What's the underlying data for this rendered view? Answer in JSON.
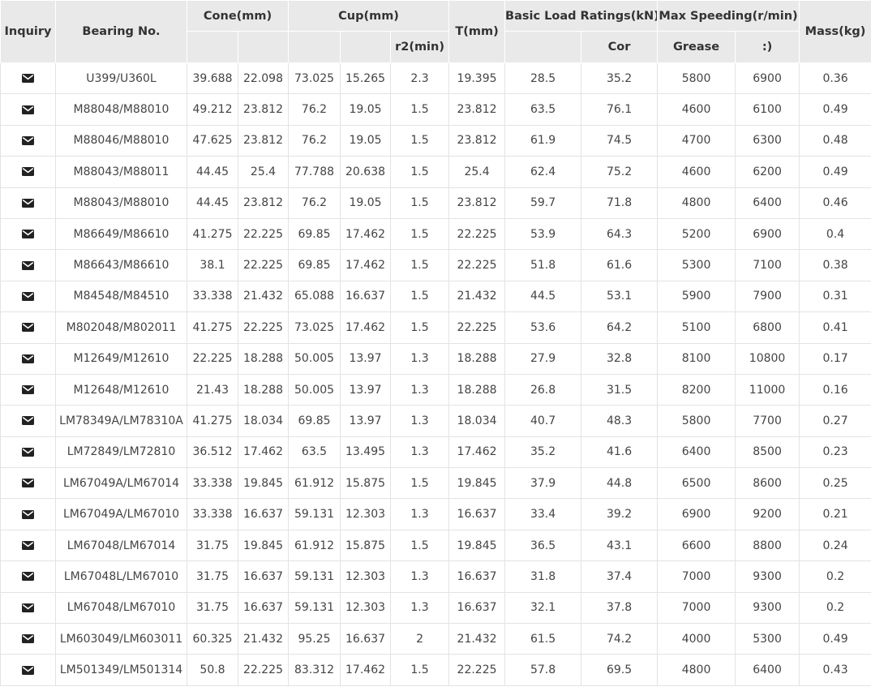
{
  "columns": {
    "inquiry": "Inquiry",
    "bearing_no": "Bearing No.",
    "cone": "Cone(mm)",
    "cup": "Cup(mm)",
    "r2_min": "r2(min)",
    "t": "T(mm)",
    "basic_load": "Basic Load Ratings(kN)",
    "cor": "Cor",
    "max_speed": "Max Speeding(r/min)",
    "grease": "Grease",
    "oil": ":)",
    "mass": "Mass(kg)"
  },
  "icons": {
    "inquiry": "envelope-icon"
  },
  "rows": [
    {
      "bearing": "U399/U360L",
      "cone1": "39.688",
      "cone2": "22.098",
      "cup1": "73.025",
      "cup2": "15.265",
      "r2": "2.3",
      "t": "19.395",
      "cr": "28.5",
      "cor": "35.2",
      "grease": "5800",
      "oil": "6900",
      "mass": "0.36"
    },
    {
      "bearing": "M88048/M88010",
      "cone1": "49.212",
      "cone2": "23.812",
      "cup1": "76.2",
      "cup2": "19.05",
      "r2": "1.5",
      "t": "23.812",
      "cr": "63.5",
      "cor": "76.1",
      "grease": "4600",
      "oil": "6100",
      "mass": "0.49"
    },
    {
      "bearing": "M88046/M88010",
      "cone1": "47.625",
      "cone2": "23.812",
      "cup1": "76.2",
      "cup2": "19.05",
      "r2": "1.5",
      "t": "23.812",
      "cr": "61.9",
      "cor": "74.5",
      "grease": "4700",
      "oil": "6300",
      "mass": "0.48"
    },
    {
      "bearing": "M88043/M88011",
      "cone1": "44.45",
      "cone2": "25.4",
      "cup1": "77.788",
      "cup2": "20.638",
      "r2": "1.5",
      "t": "25.4",
      "cr": "62.4",
      "cor": "75.2",
      "grease": "4600",
      "oil": "6200",
      "mass": "0.49"
    },
    {
      "bearing": "M88043/M88010",
      "cone1": "44.45",
      "cone2": "23.812",
      "cup1": "76.2",
      "cup2": "19.05",
      "r2": "1.5",
      "t": "23.812",
      "cr": "59.7",
      "cor": "71.8",
      "grease": "4800",
      "oil": "6400",
      "mass": "0.46"
    },
    {
      "bearing": "M86649/M86610",
      "cone1": "41.275",
      "cone2": "22.225",
      "cup1": "69.85",
      "cup2": "17.462",
      "r2": "1.5",
      "t": "22.225",
      "cr": "53.9",
      "cor": "64.3",
      "grease": "5200",
      "oil": "6900",
      "mass": "0.4"
    },
    {
      "bearing": "M86643/M86610",
      "cone1": "38.1",
      "cone2": "22.225",
      "cup1": "69.85",
      "cup2": "17.462",
      "r2": "1.5",
      "t": "22.225",
      "cr": "51.8",
      "cor": "61.6",
      "grease": "5300",
      "oil": "7100",
      "mass": "0.38"
    },
    {
      "bearing": "M84548/M84510",
      "cone1": "33.338",
      "cone2": "21.432",
      "cup1": "65.088",
      "cup2": "16.637",
      "r2": "1.5",
      "t": "21.432",
      "cr": "44.5",
      "cor": "53.1",
      "grease": "5900",
      "oil": "7900",
      "mass": "0.31"
    },
    {
      "bearing": "M802048/M802011",
      "cone1": "41.275",
      "cone2": "22.225",
      "cup1": "73.025",
      "cup2": "17.462",
      "r2": "1.5",
      "t": "22.225",
      "cr": "53.6",
      "cor": "64.2",
      "grease": "5100",
      "oil": "6800",
      "mass": "0.41"
    },
    {
      "bearing": "M12649/M12610",
      "cone1": "22.225",
      "cone2": "18.288",
      "cup1": "50.005",
      "cup2": "13.97",
      "r2": "1.3",
      "t": "18.288",
      "cr": "27.9",
      "cor": "32.8",
      "grease": "8100",
      "oil": "10800",
      "mass": "0.17"
    },
    {
      "bearing": "M12648/M12610",
      "cone1": "21.43",
      "cone2": "18.288",
      "cup1": "50.005",
      "cup2": "13.97",
      "r2": "1.3",
      "t": "18.288",
      "cr": "26.8",
      "cor": "31.5",
      "grease": "8200",
      "oil": "11000",
      "mass": "0.16"
    },
    {
      "bearing": "LM78349A/LM78310A",
      "cone1": "41.275",
      "cone2": "18.034",
      "cup1": "69.85",
      "cup2": "13.97",
      "r2": "1.3",
      "t": "18.034",
      "cr": "40.7",
      "cor": "48.3",
      "grease": "5800",
      "oil": "7700",
      "mass": "0.27"
    },
    {
      "bearing": "LM72849/LM72810",
      "cone1": "36.512",
      "cone2": "17.462",
      "cup1": "63.5",
      "cup2": "13.495",
      "r2": "1.3",
      "t": "17.462",
      "cr": "35.2",
      "cor": "41.6",
      "grease": "6400",
      "oil": "8500",
      "mass": "0.23"
    },
    {
      "bearing": "LM67049A/LM67014",
      "cone1": "33.338",
      "cone2": "19.845",
      "cup1": "61.912",
      "cup2": "15.875",
      "r2": "1.5",
      "t": "19.845",
      "cr": "37.9",
      "cor": "44.8",
      "grease": "6500",
      "oil": "8600",
      "mass": "0.25"
    },
    {
      "bearing": "LM67049A/LM67010",
      "cone1": "33.338",
      "cone2": "16.637",
      "cup1": "59.131",
      "cup2": "12.303",
      "r2": "1.3",
      "t": "16.637",
      "cr": "33.4",
      "cor": "39.2",
      "grease": "6900",
      "oil": "9200",
      "mass": "0.21"
    },
    {
      "bearing": "LM67048/LM67014",
      "cone1": "31.75",
      "cone2": "19.845",
      "cup1": "61.912",
      "cup2": "15.875",
      "r2": "1.5",
      "t": "19.845",
      "cr": "36.5",
      "cor": "43.1",
      "grease": "6600",
      "oil": "8800",
      "mass": "0.24"
    },
    {
      "bearing": "LM67048L/LM67010",
      "cone1": "31.75",
      "cone2": "16.637",
      "cup1": "59.131",
      "cup2": "12.303",
      "r2": "1.3",
      "t": "16.637",
      "cr": "31.8",
      "cor": "37.4",
      "grease": "7000",
      "oil": "9300",
      "mass": "0.2"
    },
    {
      "bearing": "LM67048/LM67010",
      "cone1": "31.75",
      "cone2": "16.637",
      "cup1": "59.131",
      "cup2": "12.303",
      "r2": "1.3",
      "t": "16.637",
      "cr": "32.1",
      "cor": "37.8",
      "grease": "7000",
      "oil": "9300",
      "mass": "0.2"
    },
    {
      "bearing": "LM603049/LM603011",
      "cone1": "60.325",
      "cone2": "21.432",
      "cup1": "95.25",
      "cup2": "16.637",
      "r2": "2",
      "t": "21.432",
      "cr": "61.5",
      "cor": "74.2",
      "grease": "4000",
      "oil": "5300",
      "mass": "0.49"
    },
    {
      "bearing": "LM501349/LM501314",
      "cone1": "50.8",
      "cone2": "22.225",
      "cup1": "83.312",
      "cup2": "17.462",
      "r2": "1.5",
      "t": "22.225",
      "cr": "57.8",
      "cor": "69.5",
      "grease": "4800",
      "oil": "6400",
      "mass": "0.43"
    }
  ]
}
